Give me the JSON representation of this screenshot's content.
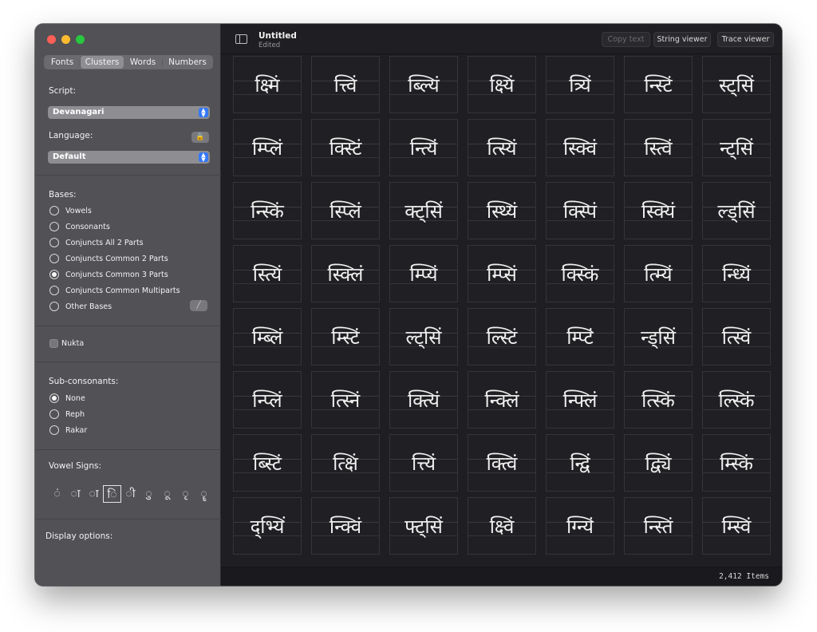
{
  "sidebar": {
    "tabs": [
      {
        "label": "Fonts",
        "active": false
      },
      {
        "label": "Clusters",
        "active": true
      },
      {
        "label": "Words",
        "active": false
      },
      {
        "label": "Numbers",
        "active": false
      }
    ],
    "script_label": "Script:",
    "script_value": "Devanagari",
    "language_label": "Language:",
    "language_value": "Default",
    "bases_label": "Bases:",
    "bases": [
      {
        "label": "Vowels",
        "selected": false
      },
      {
        "label": "Consonants",
        "selected": false
      },
      {
        "label": "Conjuncts All 2 Parts",
        "selected": false
      },
      {
        "label": "Conjuncts Common 2 Parts",
        "selected": false
      },
      {
        "label": "Conjuncts Common 3 Parts",
        "selected": true
      },
      {
        "label": "Conjuncts Common Multiparts",
        "selected": false
      },
      {
        "label": "Other Bases",
        "selected": false
      }
    ],
    "nukta_label": "Nukta",
    "subconsonants_label": "Sub-consonants:",
    "subconsonants": [
      {
        "label": "None",
        "selected": true
      },
      {
        "label": "Reph",
        "selected": false
      },
      {
        "label": "Rakar",
        "selected": false
      }
    ],
    "vowel_signs_label": "Vowel Signs:",
    "vowel_signs": [
      "ं",
      "ा",
      "ा",
      "ि",
      "ी",
      "ु",
      "ू",
      "ृ",
      "ॄ"
    ],
    "vowel_selected_index": 3,
    "display_options_label": "Display options:"
  },
  "toolbar": {
    "title": "Untitled",
    "subtitle": "Edited",
    "copy_text": "Copy text",
    "string_viewer": "String viewer",
    "trace_viewer": "Trace viewer"
  },
  "clusters": [
    "क्ष्मिं",
    "त्त्विं",
    "ब्ल्यिं",
    "क्ष्यिं",
    "त्र्यिं",
    "न्स्टिं",
    "स्ट्सिं",
    "म्प्लिं",
    "क्स्टिं",
    "न्त्यिं",
    "त्स्यिं",
    "स्क्विं",
    "स्त्विं",
    "न्ट्सिं",
    "न्स्किं",
    "स्प्लिं",
    "क्ट्सिं",
    "स्थ्यिं",
    "क्स्पिं",
    "स्क्यिं",
    "ल्ड्सिं",
    "स्त्यिं",
    "स्क्लिं",
    "म्प्यिं",
    "म्प्सिं",
    "क्स्किं",
    "त्म्यिं",
    "न्ध्यिं",
    "म्ब्लिं",
    "म्स्टिं",
    "ल्ट्सिं",
    "ल्स्टिं",
    "म्प्टिं",
    "न्ड्सिं",
    "त्स्विं",
    "न्प्लिं",
    "त्स्निं",
    "क्त्यिं",
    "न्क्लिं",
    "न्फ्लिं",
    "त्स्किं",
    "ल्स्किं",
    "ब्स्टिं",
    "त्क्षिं",
    "त्त्यिं",
    "क्त्विं",
    "न्द्विं",
    "द्व्यिं",
    "म्स्किं",
    "द्भ्यिं",
    "न्क्विं",
    "फ्ट्सिं",
    "क्ष्विं",
    "ग्न्यिं",
    "न्स्तिं",
    "म्स्विं"
  ],
  "status": {
    "item_count": "2,412 Items"
  }
}
